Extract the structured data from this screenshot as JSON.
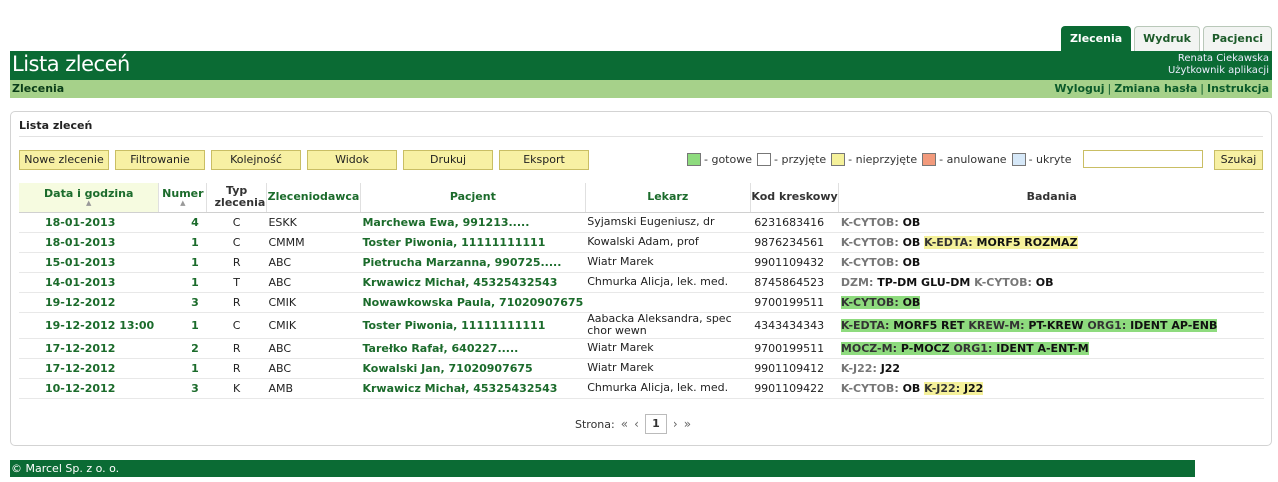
{
  "tabs": [
    {
      "label": "Zlecenia",
      "active": true
    },
    {
      "label": "Wydruk",
      "active": false
    },
    {
      "label": "Pacjenci",
      "active": false
    }
  ],
  "header": {
    "title": "Lista zleceń",
    "user_name": "Renata Ciekawska",
    "user_role": "Użytkownik aplikacji"
  },
  "subbar": {
    "crumb": "Zlecenia",
    "logout": "Wyloguj",
    "change_password": "Zmiana hasła",
    "instructions": "Instrukcja",
    "separator": "|"
  },
  "panel": {
    "title": "Lista zleceń"
  },
  "toolbar": {
    "new_order": "Nowe zlecenie",
    "filter": "Filtrowanie",
    "order": "Kolejność",
    "view": "Widok",
    "print": "Drukuj",
    "export": "Eksport"
  },
  "legend": [
    {
      "label": "- gotowe",
      "color": "#8edb7e"
    },
    {
      "label": "- przyjęte",
      "color": "#ffffff"
    },
    {
      "label": "- nieprzyjęte",
      "color": "#f5f19a"
    },
    {
      "label": "- anulowane",
      "color": "#f29a7c"
    },
    {
      "label": "- ukryte",
      "color": "#d6e8f8"
    }
  ],
  "search": {
    "value": "",
    "button": "Szukaj"
  },
  "table": {
    "headers": {
      "date": "Data i godzina",
      "number": "Numer",
      "type": "Typ zlecenia",
      "orderer": "Zleceniodawca",
      "patient": "Pacjent",
      "doctor": "Lekarz",
      "barcode": "Kod kreskowy",
      "tests": "Badania"
    },
    "rows": [
      {
        "date": "18-01-2013",
        "number": "4",
        "type": "C",
        "orderer": "ESKK",
        "patient": "Marchewa Ewa, 991213.....",
        "doctor": "Syjamski Eugeniusz, dr",
        "barcode": "6231683416",
        "tests": [
          {
            "code": "K-CYTOB:",
            "val": "OB",
            "hl": ""
          }
        ]
      },
      {
        "date": "18-01-2013",
        "number": "1",
        "type": "C",
        "orderer": "CMMM",
        "patient": "Toster Piwonia, 11111111111",
        "doctor": "Kowalski Adam, prof",
        "barcode": "9876234561",
        "tests": [
          {
            "code": "K-CYTOB:",
            "val": "OB",
            "hl": ""
          },
          {
            "code": "K-EDTA:",
            "val": "MORF5 ROZMAZ",
            "hl": "y"
          }
        ]
      },
      {
        "date": "15-01-2013",
        "number": "1",
        "type": "R",
        "orderer": "ABC",
        "patient": "Pietrucha Marzanna, 990725.....",
        "doctor": "Wiatr Marek",
        "barcode": "9901109432",
        "tests": [
          {
            "code": "K-CYTOB:",
            "val": "OB",
            "hl": ""
          }
        ]
      },
      {
        "date": "14-01-2013",
        "number": "1",
        "type": "T",
        "orderer": "ABC",
        "patient": "Krwawicz Michał, 45325432543",
        "doctor": "Chmurka Alicja, lek. med.",
        "barcode": "8745864523",
        "tests": [
          {
            "code": "DZM:",
            "val": "TP-DM GLU-DM",
            "hl": ""
          },
          {
            "code": "K-CYTOB:",
            "val": "OB",
            "hl": ""
          }
        ]
      },
      {
        "date": "19-12-2012",
        "number": "3",
        "type": "R",
        "orderer": "CMIK",
        "patient": "Nowawkowska Paula, 71020907675",
        "doctor": "",
        "barcode": "9700199511",
        "tests": [
          {
            "code": "K-CYTOB:",
            "val": "OB",
            "hl": "g"
          }
        ]
      },
      {
        "date": "19-12-2012 13:00",
        "number": "1",
        "type": "C",
        "orderer": "CMIK",
        "patient": "Toster Piwonia, 11111111111",
        "doctor": "Aabacka Aleksandra, spec chor wewn",
        "barcode": "4343434343",
        "tall": true,
        "tests": [
          {
            "code": "K-EDTA:",
            "val": "MORF5 RET",
            "hl": "g"
          },
          {
            "code": "KREW-M:",
            "val": "PT-KREW",
            "hl": "g"
          },
          {
            "code": "ORG1:",
            "val": "IDENT AP-ENB",
            "hl": "g"
          }
        ]
      },
      {
        "date": "17-12-2012",
        "number": "2",
        "type": "R",
        "orderer": "ABC",
        "patient": "Tarełko Rafał, 640227.....",
        "doctor": "Wiatr Marek",
        "barcode": "9700199511",
        "tests": [
          {
            "code": "MOCZ-M:",
            "val": "P-MOCZ",
            "hl": "g"
          },
          {
            "code": "ORG1:",
            "val": "IDENT A-ENT-M",
            "hl": "g"
          }
        ]
      },
      {
        "date": "17-12-2012",
        "number": "1",
        "type": "R",
        "orderer": "ABC",
        "patient": "Kowalski Jan, 71020907675",
        "doctor": "Wiatr Marek",
        "barcode": "9901109412",
        "tests": [
          {
            "code": "K-J22:",
            "val": "J22",
            "hl": ""
          }
        ]
      },
      {
        "date": "10-12-2012",
        "number": "3",
        "type": "K",
        "orderer": "AMB",
        "patient": "Krwawicz Michał, 45325432543",
        "doctor": "Chmurka Alicja, lek. med.",
        "barcode": "9901109422",
        "tests": [
          {
            "code": "K-CYTOB:",
            "val": "OB",
            "hl": ""
          },
          {
            "code": "K-J22:",
            "val": "J22",
            "hl": "y"
          }
        ]
      }
    ]
  },
  "pager": {
    "label": "Strona:",
    "first": "«",
    "prev": "‹",
    "current": "1",
    "next": "›",
    "last": "»"
  },
  "footer": {
    "text": "© Marcel Sp. z o. o."
  }
}
